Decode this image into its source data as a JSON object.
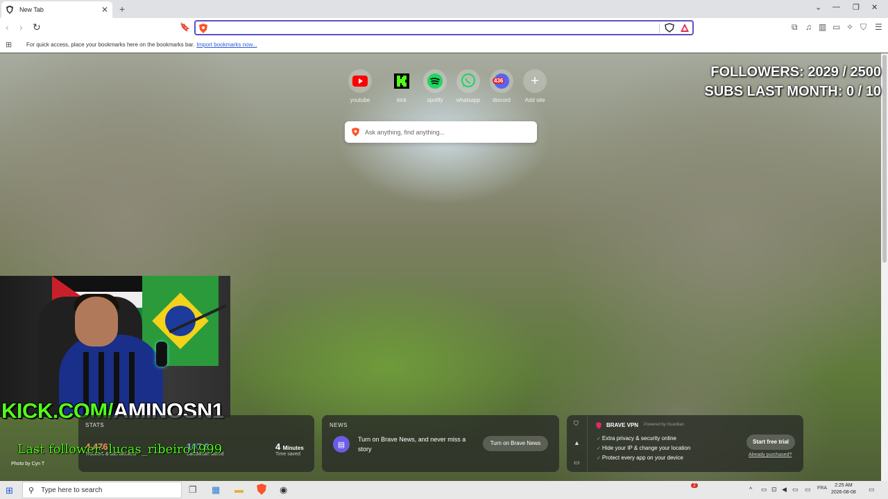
{
  "tab": {
    "title": "New Tab"
  },
  "bookmarks_bar": {
    "message": "For quick access, place your bookmarks here on the bookmarks bar.",
    "import_link": "Import bookmarks now..."
  },
  "top_sites": [
    {
      "label": "youtube",
      "icon": "youtube-icon"
    },
    {
      "label": "kick",
      "icon": "kick-icon"
    },
    {
      "label": "spotify",
      "icon": "spotify-icon"
    },
    {
      "label": "whatsapp",
      "icon": "whatsapp-icon"
    },
    {
      "label": "discord",
      "icon": "discord-icon",
      "badge": "436"
    },
    {
      "label": "Add site",
      "icon": "plus-icon"
    }
  ],
  "search": {
    "placeholder": "Ask anything, find anything..."
  },
  "overlay": {
    "followers": "FOLLOWERS: 2029 / 2500",
    "subs": "SUBS LAST MONTH: 0 / 10",
    "kick_green": "KICK.COM/",
    "kick_white": "AMINOSN1",
    "last_follower": "Last follower: lucas_ribeiro1999"
  },
  "photo_credit": "Photo by Cyn T",
  "stats": {
    "title": "STATS",
    "trackers_value": "4,476",
    "trackers_label": "Trackers & ads blocked",
    "bandwidth_value": "107.6",
    "bandwidth_label": "Bandwidth saved",
    "time_value": "4",
    "time_unit": "Minutes",
    "time_label": "Time saved"
  },
  "news": {
    "title": "NEWS",
    "text": "Turn on Brave News, and never miss a story",
    "button": "Turn on Brave News"
  },
  "vpn": {
    "title": "BRAVE VPN",
    "powered_by": "Powered by  Guardian",
    "features": [
      "Extra privacy & security online",
      "Hide your IP & change your location",
      "Protect every app on your device"
    ],
    "button": "Start free trial",
    "already": "Already purchased?"
  },
  "taskbar": {
    "search_placeholder": "Type here to search",
    "time": "2:25 AM",
    "date": "2026-08-08",
    "lang": "FRA",
    "notification_count": "2"
  },
  "colors": {
    "brave_orange": "#fb542b",
    "address_focus": "#5b4ec9",
    "kick_green": "#53fc18"
  }
}
